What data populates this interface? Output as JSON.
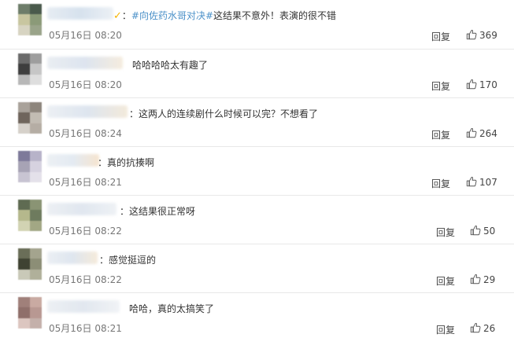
{
  "comments": [
    {
      "verified_mark": "✓",
      "colon": "：",
      "topic": "#向佐药水哥对决#",
      "text": "这结果不意外！表演的很不错",
      "time": "05月16日 08:20",
      "reply_label": "回复",
      "likes": "369"
    },
    {
      "verified_mark": "",
      "colon": "",
      "topic": "",
      "text": "哈哈哈哈太有趣了",
      "time": "05月16日 08:20",
      "reply_label": "回复",
      "likes": "170"
    },
    {
      "verified_mark": "",
      "colon": "：",
      "topic": "",
      "text": "这两人的连续剧什么时候可以完？不想看了",
      "time": "05月16日 08:24",
      "reply_label": "回复",
      "likes": "264"
    },
    {
      "verified_mark": "",
      "colon": "：",
      "topic": "",
      "text": "真的抗揍啊",
      "time": "05月16日 08:21",
      "reply_label": "回复",
      "likes": "107"
    },
    {
      "verified_mark": "",
      "colon": "：",
      "topic": "",
      "text": "这结果很正常呀",
      "time": "05月16日 08:22",
      "reply_label": "回复",
      "likes": "50"
    },
    {
      "verified_mark": "",
      "colon": "：",
      "topic": "",
      "text": "感觉挺逗的",
      "time": "05月16日 08:22",
      "reply_label": "回复",
      "likes": "29"
    },
    {
      "verified_mark": "",
      "colon": "",
      "topic": "",
      "text": "哈哈，真的太搞笑了",
      "time": "05月16日 08:21",
      "reply_label": "回复",
      "likes": "26"
    }
  ],
  "icons": {
    "like": "thumbs-up-icon"
  },
  "colors": {
    "topic": "#4a90c8",
    "verified": "#f5b400",
    "text": "#333333",
    "time": "#777777",
    "divider": "#e8e8e8"
  }
}
